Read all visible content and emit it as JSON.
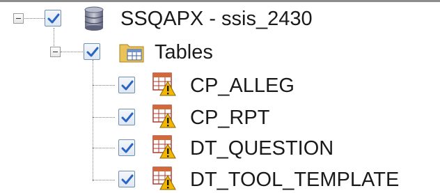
{
  "tree": {
    "database": {
      "label": "SSQAPX - ssis_2430",
      "icon": "database-icon",
      "checked": true,
      "expanded": true
    },
    "folder": {
      "label": "Tables",
      "icon": "folder-table-icon",
      "checked": true,
      "expanded": true
    },
    "tables": [
      {
        "label": "CP_ALLEG",
        "icon": "table-warning-icon",
        "checked": true
      },
      {
        "label": "CP_RPT",
        "icon": "table-warning-icon",
        "checked": true
      },
      {
        "label": "DT_QUESTION",
        "icon": "table-warning-icon",
        "checked": true
      },
      {
        "label": "DT_TOOL_TEMPLATE",
        "icon": "table-warning-icon",
        "checked": true
      }
    ]
  },
  "colors": {
    "checkmark": "#2a64c5",
    "tree_line": "#7a7a7a",
    "warning": "#f2b705"
  }
}
